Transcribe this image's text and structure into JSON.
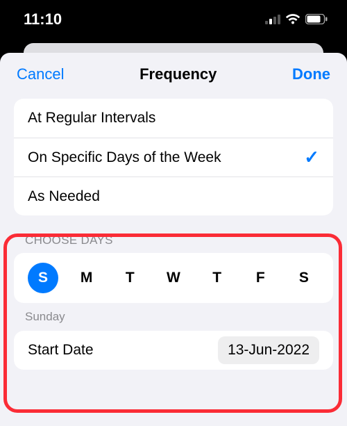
{
  "status": {
    "time": "11:10"
  },
  "nav": {
    "cancel": "Cancel",
    "title": "Frequency",
    "done": "Done"
  },
  "options": {
    "regular": "At Regular Intervals",
    "specific": "On Specific Days of the Week",
    "asneeded": "As Needed",
    "selected": "specific"
  },
  "choose": {
    "header": "CHOOSE DAYS",
    "days": [
      "S",
      "M",
      "T",
      "W",
      "T",
      "F",
      "S"
    ],
    "selected_index": 0,
    "selected_caption": "Sunday"
  },
  "start": {
    "label": "Start Date",
    "value": "13-Jun-2022"
  }
}
